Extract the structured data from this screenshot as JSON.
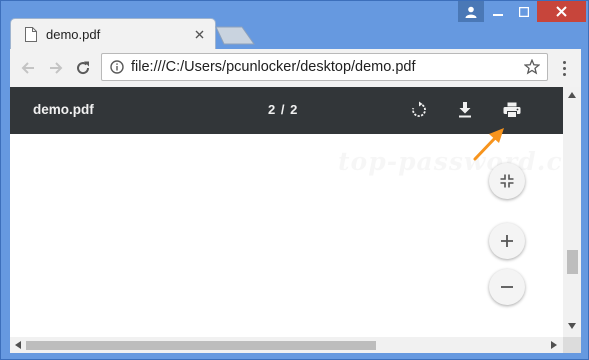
{
  "window": {
    "tab_title": "demo.pdf",
    "controls": [
      "user",
      "minimize",
      "maximize",
      "close"
    ]
  },
  "toolbar": {
    "url": "file:///C:/Users/pcunlocker/desktop/demo.pdf"
  },
  "pdf_viewer": {
    "file_name": "demo.pdf",
    "page_indicator": "2 / 2",
    "actions": [
      "rotate-icon",
      "download-icon",
      "print-icon"
    ],
    "zoom_controls": [
      "fit-page-icon",
      "zoom-in-icon",
      "zoom-out-icon"
    ]
  },
  "watermark": "top-password.com",
  "colors": {
    "pdf_toolbar": "#323639",
    "highlight_arrow": "#f7941d",
    "window_frame": "#6699e0",
    "close_button": "#c7453b"
  }
}
